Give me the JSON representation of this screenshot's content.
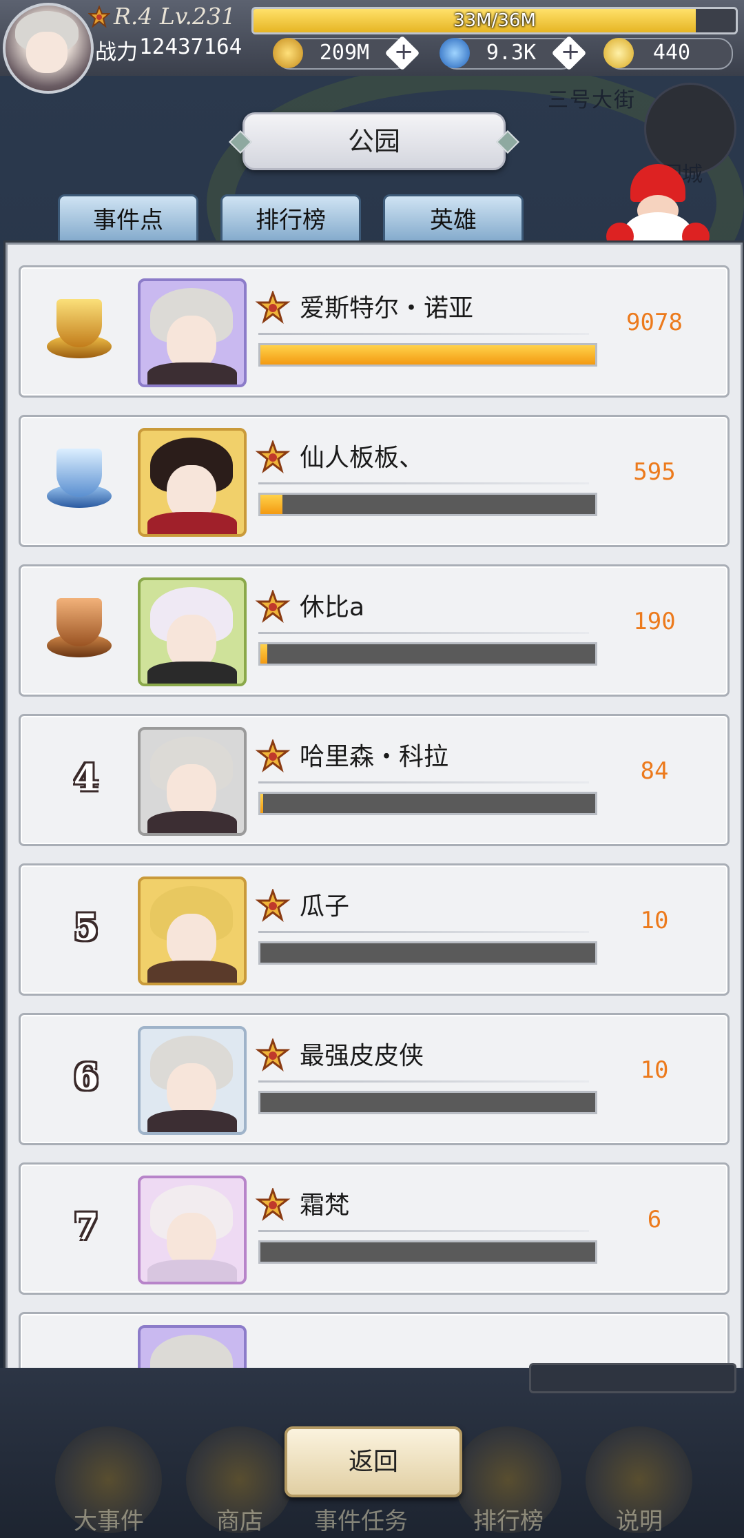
{
  "header": {
    "rank_level": "R.4 Lv.231",
    "exp_text": "33M/36M",
    "exp_progress": 0.917,
    "power_label": "战力",
    "power_value": "12437164",
    "resources": [
      {
        "icon": "gold-coin-icon",
        "value": "209M"
      },
      {
        "icon": "blue-diamond-icon",
        "value": "9.3K"
      },
      {
        "icon": "gold-crystal-icon",
        "value": "440"
      }
    ]
  },
  "background": {
    "street_label": "三号大街",
    "castle_label": "回城"
  },
  "page_title": "公园",
  "tabs": [
    {
      "label": "事件点"
    },
    {
      "label": "排行榜"
    },
    {
      "label": "英雄"
    }
  ],
  "leaderboard": [
    {
      "rank": "1",
      "trophy": "gold-trophy-icon",
      "name": "爱斯特尔・诺亚",
      "score": "9078",
      "progress": 1.0
    },
    {
      "rank": "2",
      "trophy": "silver-trophy-icon",
      "name": "仙人板板、",
      "score": "595",
      "progress": 0.066
    },
    {
      "rank": "3",
      "trophy": "bronze-trophy-icon",
      "name": "休比a",
      "score": "190",
      "progress": 0.021
    },
    {
      "rank": "4",
      "name": "哈里森・科拉",
      "score": "84",
      "progress": 0.009
    },
    {
      "rank": "5",
      "name": "瓜子",
      "score": "10",
      "progress": 0.0
    },
    {
      "rank": "6",
      "name": "最强皮皮侠",
      "score": "10",
      "progress": 0.0
    },
    {
      "rank": "7",
      "name": "霜梵",
      "score": "6",
      "progress": 0.0
    }
  ],
  "bottom_nav": [
    {
      "label": "大事件",
      "icon": "sword-icon"
    },
    {
      "label": "商店",
      "icon": "shop-icon"
    },
    {
      "label": "事件任务",
      "icon": "quest-icon"
    },
    {
      "label": "排行榜",
      "icon": "trophy-icon"
    },
    {
      "label": "说明",
      "icon": "question-icon"
    }
  ],
  "back_button": "返回",
  "colors": {
    "accent_orange": "#ec7a1c",
    "bar_fill": "#f39a12",
    "tab_blue": "#7ea6c9"
  }
}
